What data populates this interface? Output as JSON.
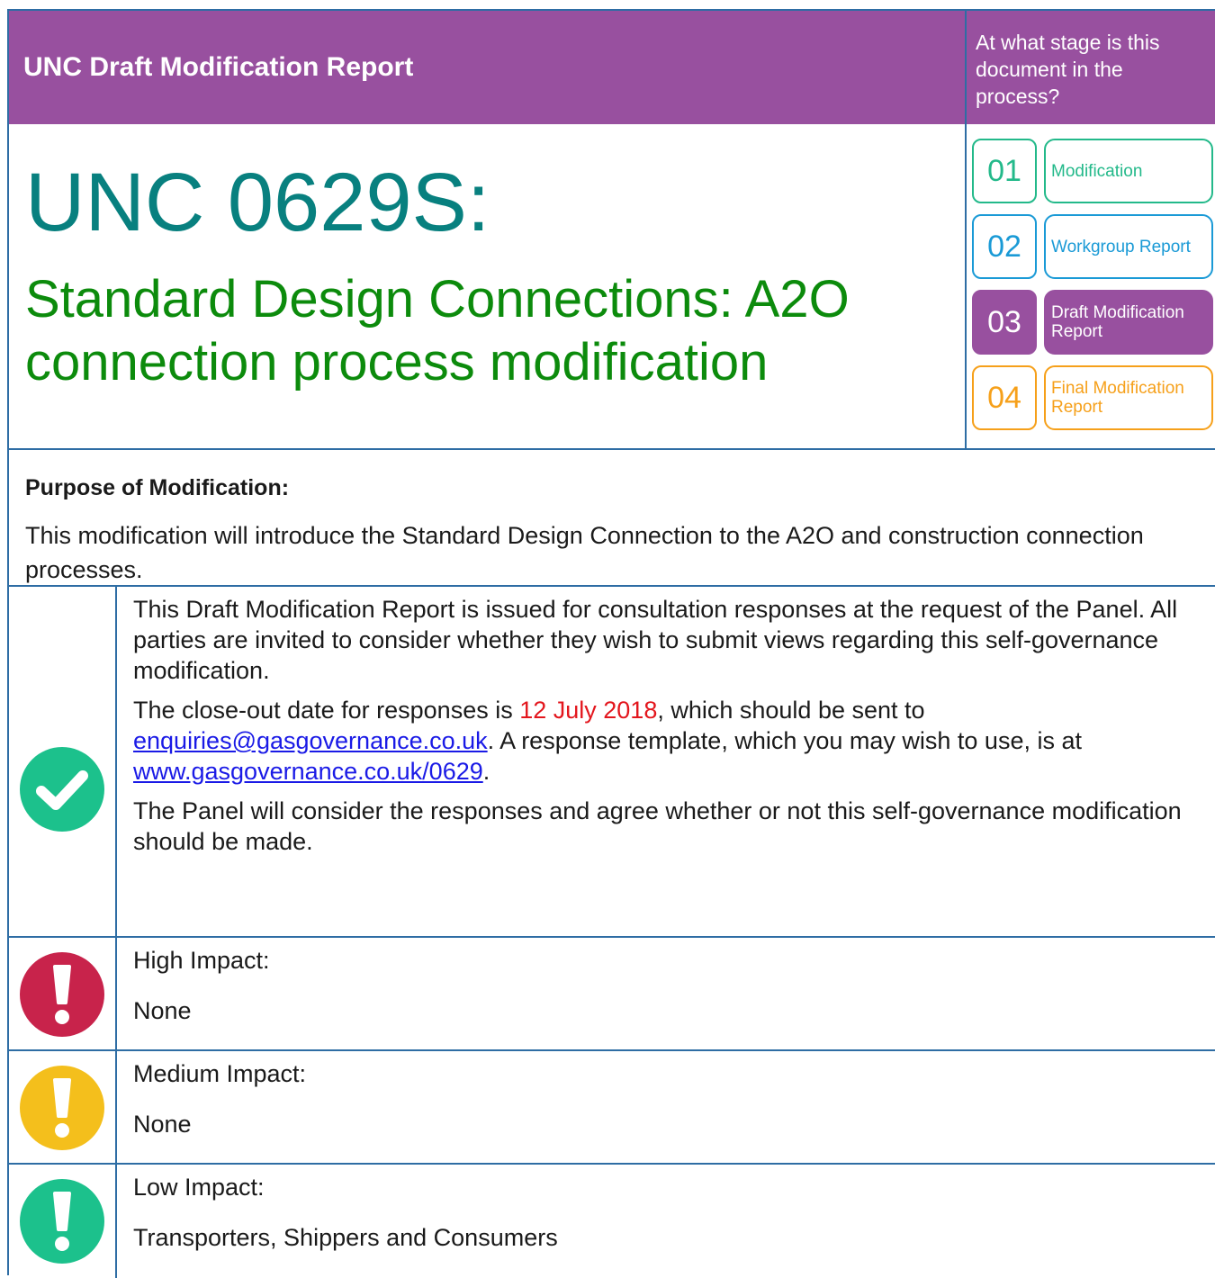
{
  "header": {
    "title": "UNC Draft Modification Report",
    "stage_question": "At what stage is this document in the process?"
  },
  "modification": {
    "number": "UNC 0629S:",
    "title": "Standard Design Connections: A2O connection process modification"
  },
  "stages": [
    {
      "number": "01",
      "label": "Modification",
      "color": "#23b98a",
      "active": false
    },
    {
      "number": "02",
      "label": "Workgroup Report",
      "color": "#1a9ad6",
      "active": false
    },
    {
      "number": "03",
      "label": "Draft Modification Report",
      "color": "#98509f",
      "active": true
    },
    {
      "number": "04",
      "label": "Final Modification Report",
      "color": "#f6a01a",
      "active": false
    }
  ],
  "purpose": {
    "heading": "Purpose of Modification:",
    "text": "This modification will introduce the Standard Design Connection to the A2O and construction connection processes."
  },
  "consultation": {
    "icon": "checkmark-icon",
    "para1": "This Draft Modification Report is issued for consultation responses at the request of the Panel. All parties are invited to consider whether they wish to submit views regarding this self-governance modification.",
    "para2_a": "The close-out date for responses is ",
    "close_date": "12 July 2018",
    "para2_b": ", which should be sent to ",
    "email": "enquiries@gasgovernance.co.uk",
    "para2_c": ".  A response template, which you may wish to use, is at ",
    "template_url": "www.gasgovernance.co.uk/0629",
    "para2_d": ".",
    "para3": "The Panel will consider the responses and agree whether or not this self-governance modification should be made."
  },
  "impacts": [
    {
      "label": "High Impact:",
      "value": "None",
      "color": "#c8234b",
      "icon": "exclamation-icon"
    },
    {
      "label": "Medium Impact:",
      "value": "None",
      "color": "#f4bf1c",
      "icon": "exclamation-icon"
    },
    {
      "label": "Low Impact:",
      "value": "Transporters, Shippers and Consumers",
      "color": "#1cc18c",
      "icon": "exclamation-icon"
    }
  ]
}
